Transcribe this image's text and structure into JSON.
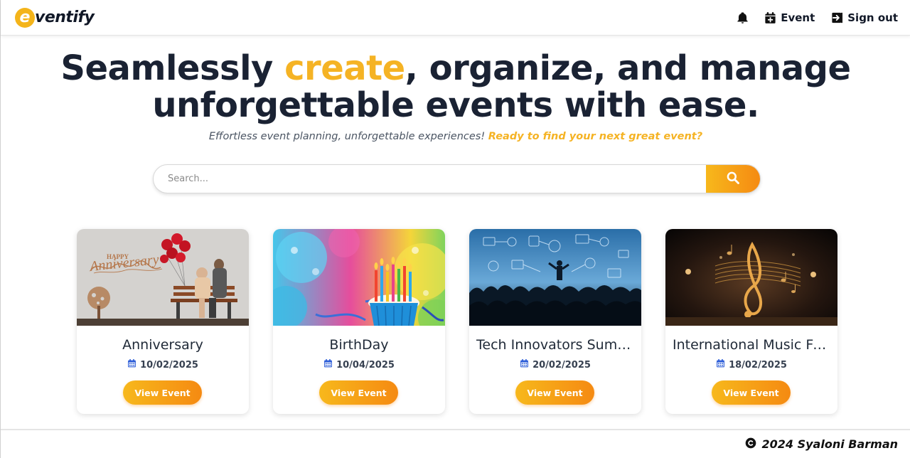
{
  "brand": {
    "logo_letter": "e",
    "logo_rest": "ventify"
  },
  "nav": {
    "bell_icon": "bell-icon",
    "event_label": "Event",
    "signout_label": "Sign out"
  },
  "hero": {
    "title_part1": "Seamlessly ",
    "title_accent": "create",
    "title_part2": ", organize, and manage",
    "title_line2": "unforgettable events with ease.",
    "subtitle": "Effortless event planning, unforgettable experiences! ",
    "subtitle_accent": "Ready to find your next great event?"
  },
  "search": {
    "placeholder": "Search...",
    "value": ""
  },
  "cards": [
    {
      "title": "Anniversary",
      "date": "10/02/2025",
      "button": "View Event"
    },
    {
      "title": "BirthDay",
      "date": "10/04/2025",
      "button": "View Event"
    },
    {
      "title": "Tech Innovators Summit",
      "date": "20/02/2025",
      "button": "View Event"
    },
    {
      "title": "International Music Festival",
      "date": "18/02/2025",
      "button": "View Event"
    }
  ],
  "footer": {
    "text": "2024 Syaloni Barman"
  },
  "colors": {
    "accent": "#f5b324",
    "accent_end": "#f58a12",
    "text_dark": "#1a2233",
    "calendar_blue": "#2a5bd7"
  }
}
